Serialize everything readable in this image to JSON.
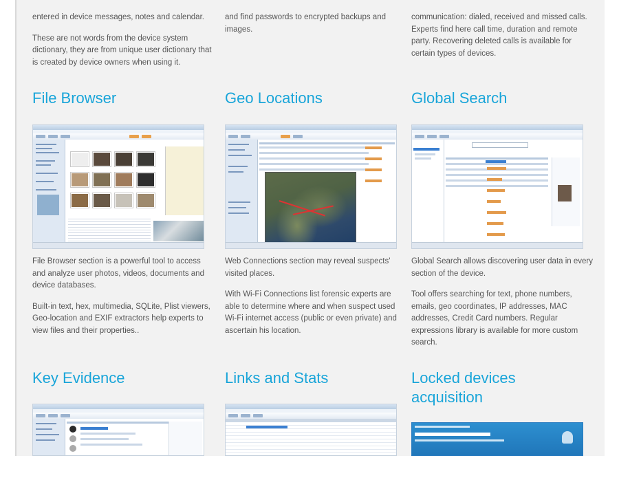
{
  "top_row": {
    "col1": [
      "entered in device messages, notes and calendar.",
      "These are not words from the device system dictionary, they are from unique user dictionary that is created by device owners when using it."
    ],
    "col2": [
      "and find passwords to encrypted backups and images."
    ],
    "col3": [
      "communication: dialed, received and missed calls. Experts find here call time, duration and remote party. Recovering deleted calls is available for certain types of devices."
    ]
  },
  "features": [
    {
      "title": "File Browser",
      "paragraphs": [
        "File Browser section is a powerful tool to access and analyze user photos, videos, documents and device databases.",
        "Built-in text, hex, multimedia, SQLite, Plist viewers, Geo-location and EXIF extractors help experts to view files and their properties.."
      ]
    },
    {
      "title": "Geo Locations",
      "paragraphs": [
        "Web Connections section may reveal suspects' visited places.",
        "With Wi-Fi Connections list forensic experts are able to determine where and when suspect used Wi-Fi internet access (public or even private) and ascertain his location."
      ]
    },
    {
      "title": "Global Search",
      "paragraphs": [
        "Global Search allows discovering user data in every section of the device.",
        "Tool offers searching for text, phone numbers, emails, geo coordinates, IP addresses, MAC addresses, Credit Card numbers. Regular expressions library is available for more custom search."
      ]
    },
    {
      "title": "Key Evidence"
    },
    {
      "title": "Links and Stats"
    },
    {
      "title": "Locked devices acquisition"
    }
  ],
  "colors": {
    "heading": "#19a5d9",
    "body_text": "#555555",
    "panel_bg": "#f2f2f2"
  }
}
